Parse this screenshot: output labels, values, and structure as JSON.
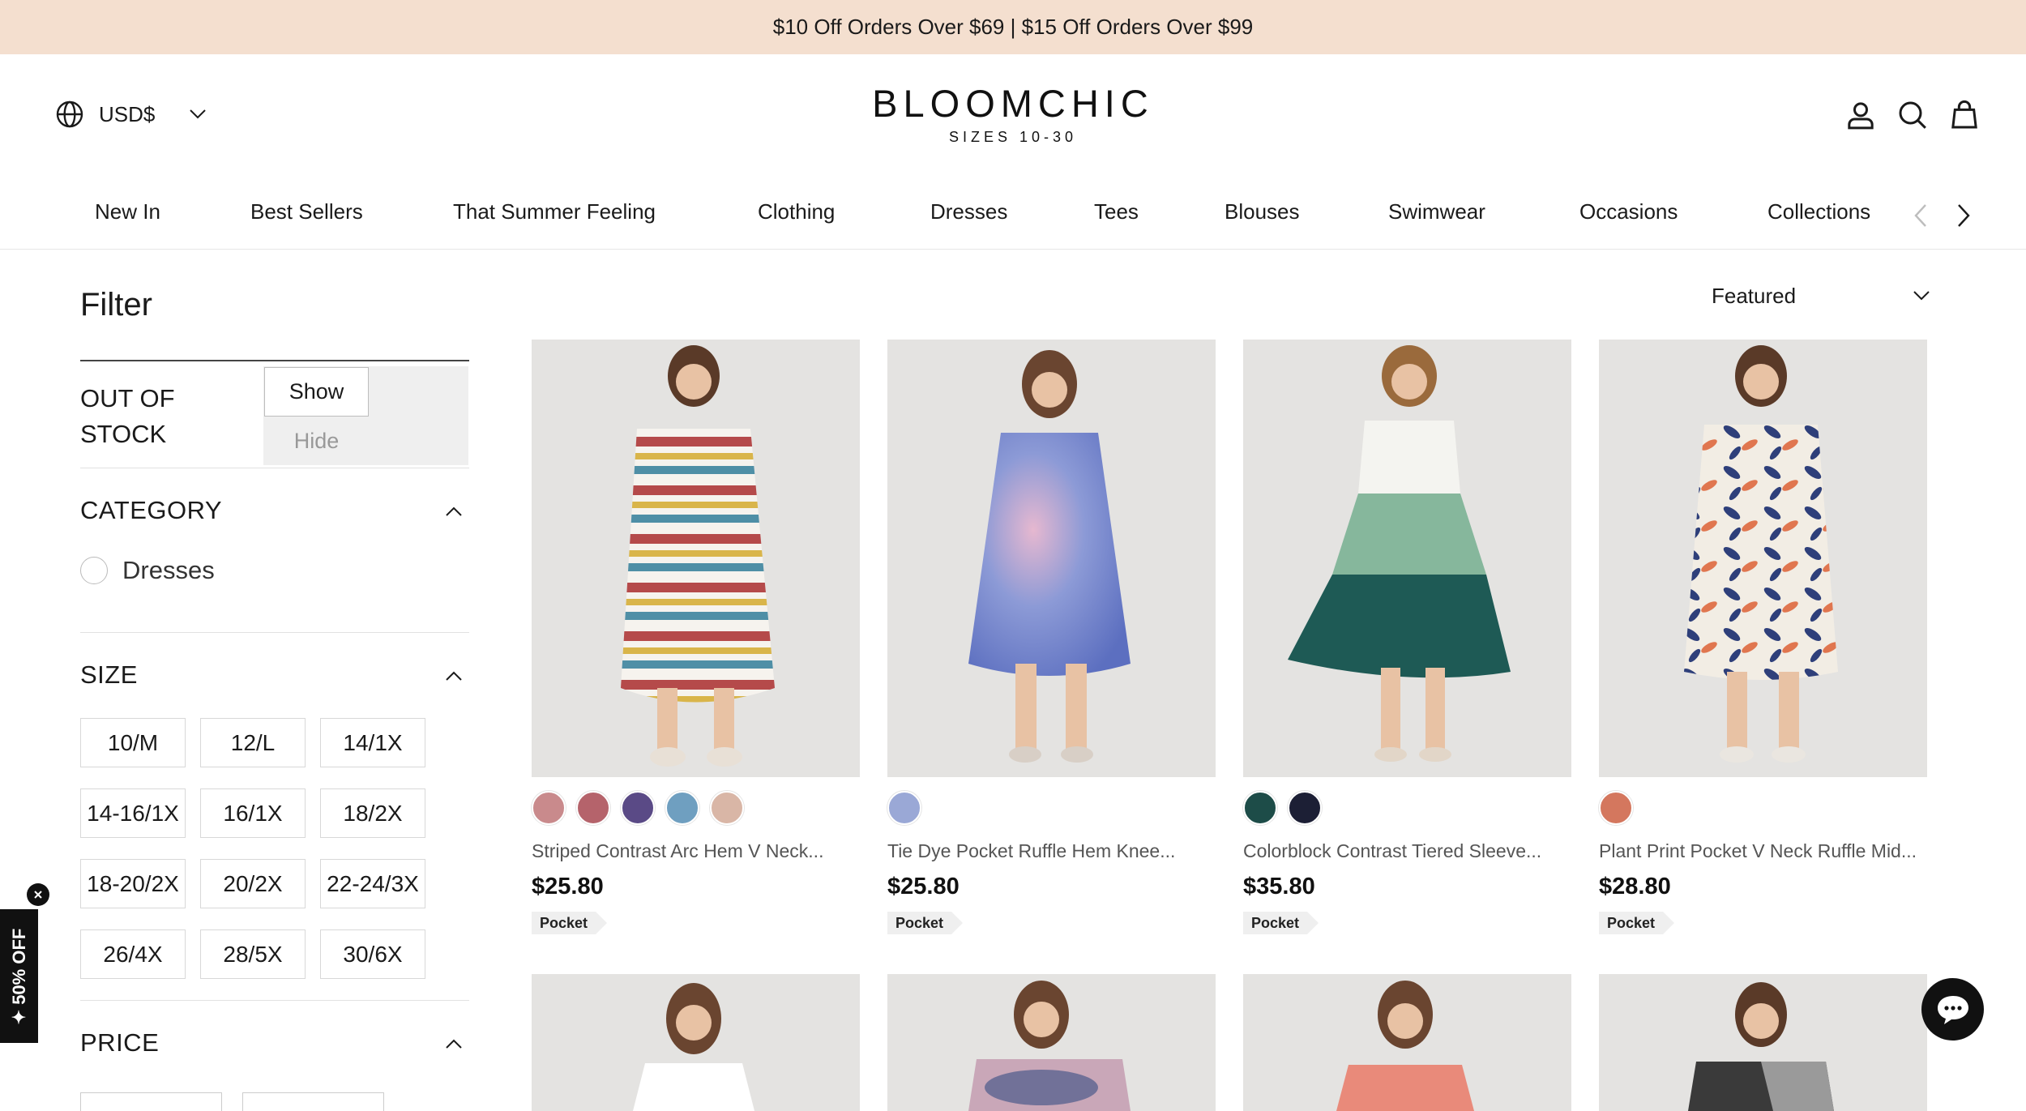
{
  "promo_banner": {
    "text": "$10 Off Orders Over $69 | $15 Off Orders Over $99"
  },
  "header": {
    "currency": "USD$",
    "logo_brand": "BLOOMCHIC",
    "logo_tagline": "SIZES 10-30",
    "icons": [
      "globe-icon",
      "chevron-down-icon",
      "account-icon",
      "search-icon",
      "bag-icon"
    ]
  },
  "nav": {
    "items": [
      "New In",
      "Best Sellers",
      "That Summer Feeling",
      "Clothing",
      "Dresses",
      "Tees",
      "Blouses",
      "Swimwear",
      "Occasions",
      "Collections"
    ]
  },
  "filter": {
    "title": "Filter",
    "out_of_stock": {
      "label": "OUT OF STOCK",
      "options": [
        "Show",
        "Hide"
      ],
      "selected": "Show"
    },
    "category": {
      "title": "CATEGORY",
      "options": [
        "Dresses"
      ]
    },
    "size": {
      "title": "SIZE",
      "options": [
        "10/M",
        "12/L",
        "14/1X",
        "14-16/1X",
        "16/1X",
        "18/2X",
        "18-20/2X",
        "20/2X",
        "22-24/3X",
        "26/4X",
        "28/5X",
        "30/6X"
      ]
    },
    "price": {
      "title": "PRICE"
    }
  },
  "sort": {
    "selected": "Featured"
  },
  "products": [
    {
      "name": "Striped Contrast Arc Hem V Neck...",
      "price": "$25.80",
      "tag": "Pocket",
      "swatches": [
        "#c98a8c",
        "#b5636b",
        "#5a4a86",
        "#6f9fc0",
        "#d9b6a6"
      ]
    },
    {
      "name": "Tie Dye Pocket Ruffle Hem Knee...",
      "price": "$25.80",
      "tag": "Pocket",
      "swatches": [
        "#9aa8d6"
      ]
    },
    {
      "name": "Colorblock Contrast Tiered Sleeve...",
      "price": "$35.80",
      "tag": "Pocket",
      "swatches": [
        "#1d4c48",
        "#1c1f35"
      ]
    },
    {
      "name": "Plant Print Pocket V Neck Ruffle Mid...",
      "price": "$28.80",
      "tag": "Pocket",
      "swatches": [
        "#d4775e"
      ]
    }
  ],
  "side_promo": {
    "text": "✦ 50% OFF"
  },
  "colors": {
    "promo_bg": "#f4dfcf",
    "text": "#1a1a1a",
    "photo_bg": "#e4e3e1",
    "tag_bg": "#efefef",
    "promo_badge": "#111111"
  }
}
